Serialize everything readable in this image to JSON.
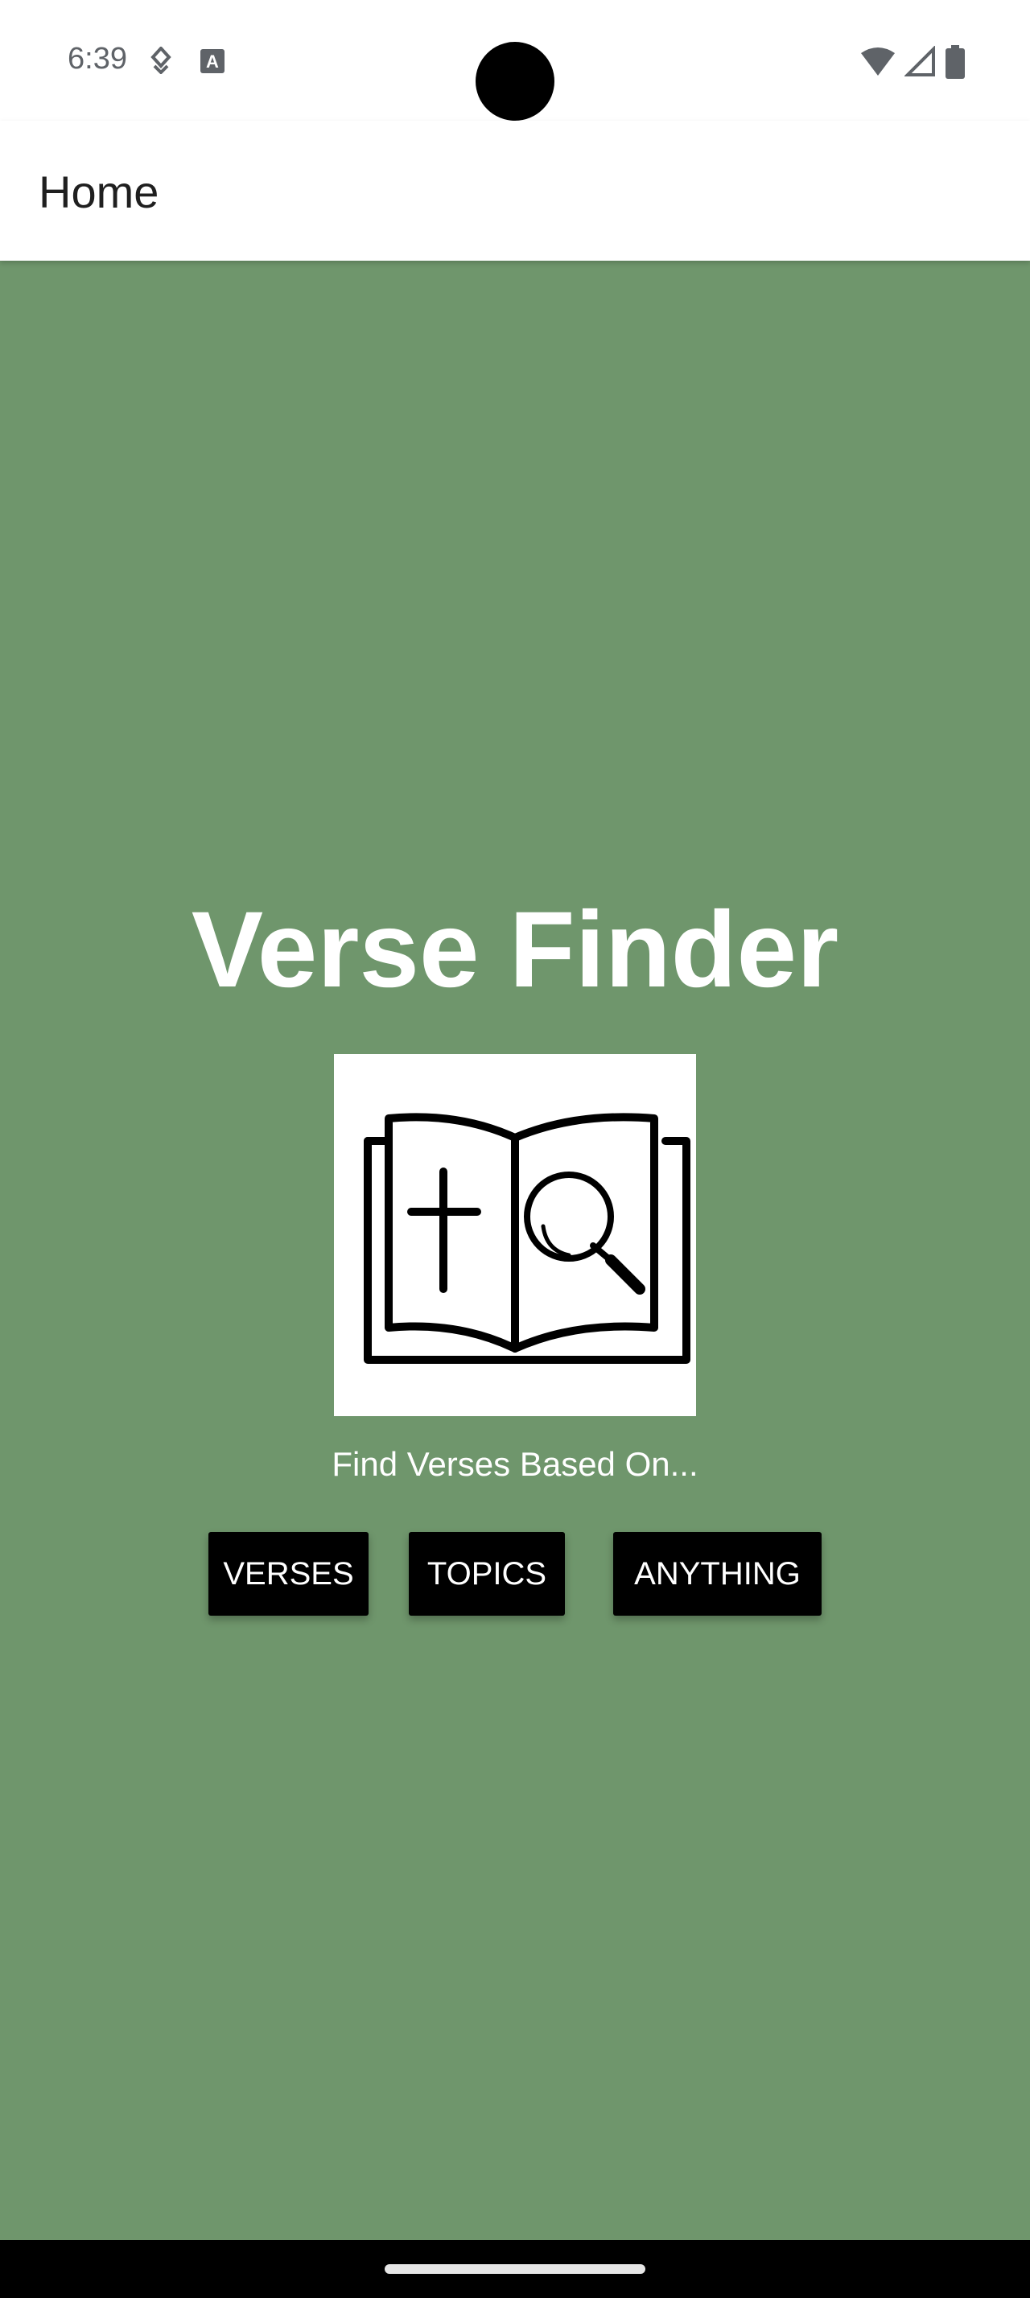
{
  "status_bar": {
    "time": "6:39",
    "icons": [
      "navigation-status-icon",
      "accessibility-a-icon",
      "wifi-icon",
      "cellular-signal-icon",
      "battery-icon"
    ]
  },
  "app_bar": {
    "title": "Home"
  },
  "main": {
    "background_color": "#6f966c",
    "title": "Verse Finder",
    "logo": "open-bible-cross-magnifier-icon",
    "subtitle": "Find Verses Based On...",
    "buttons": [
      {
        "label": "VERSES"
      },
      {
        "label": "TOPICS"
      },
      {
        "label": "ANYTHING"
      }
    ]
  },
  "colors": {
    "button_bg": "#000000",
    "button_text": "#ffffff",
    "app_bar_bg": "#ffffff"
  }
}
